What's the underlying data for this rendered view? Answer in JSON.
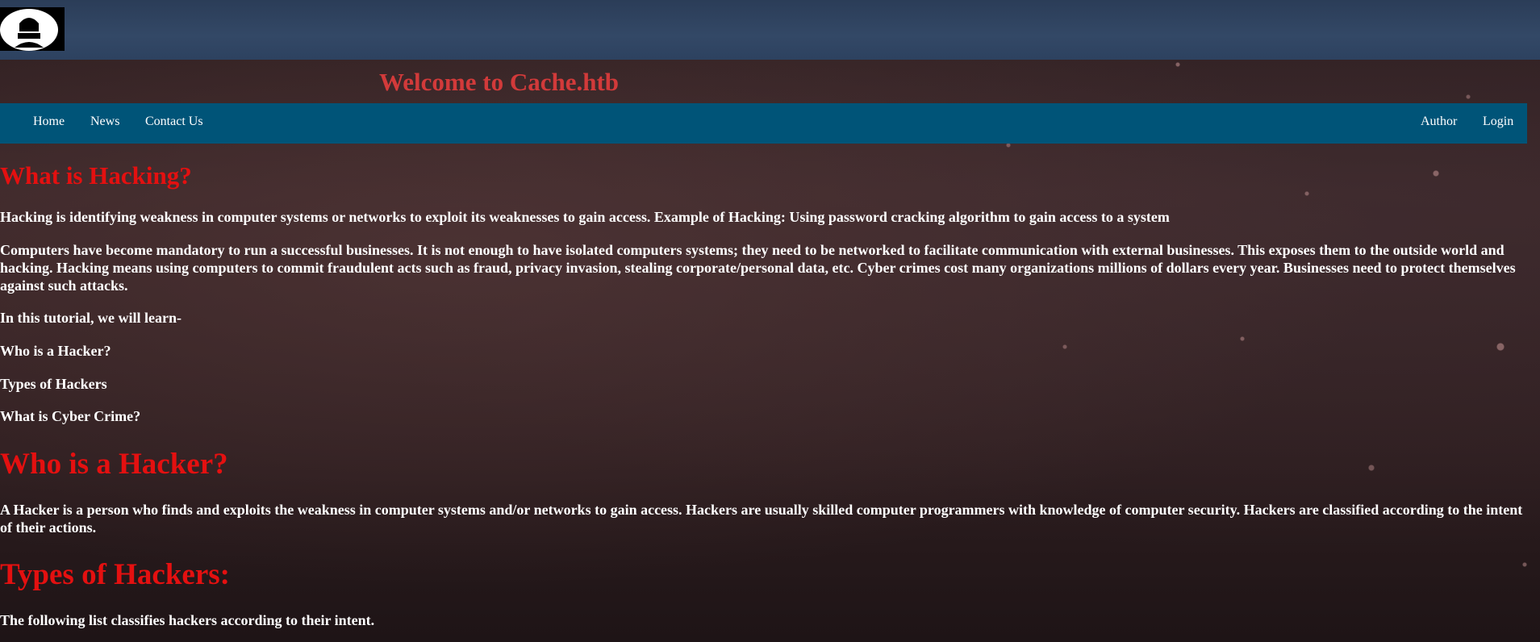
{
  "header": {
    "logo_icon": "hacker-avatar-icon",
    "title": "Welcome to Cache.htb"
  },
  "nav": {
    "left": [
      "Home",
      "News",
      "Contact Us"
    ],
    "right": [
      "Author",
      "Login"
    ]
  },
  "colors": {
    "nav_background": "#005478",
    "heading": "#e41010",
    "site_title": "#d23a3a",
    "text": "#ffffff"
  },
  "content": {
    "section1": {
      "heading": "What is Hacking?",
      "p1": "Hacking is identifying weakness in computer systems or networks to exploit its weaknesses to gain access. Example of Hacking: Using password cracking algorithm to gain access to a system",
      "p2": "Computers have become mandatory to run a successful businesses. It is not enough to have isolated computers systems; they need to be networked to facilitate communication with external businesses. This exposes them to the outside world and hacking. Hacking means using computers to commit fraudulent acts such as fraud, privacy invasion, stealing corporate/personal data, etc. Cyber crimes cost many organizations millions of dollars every year. Businesses need to protect themselves against such attacks.",
      "p3": "In this tutorial, we will learn-",
      "toc": [
        "Who is a Hacker?",
        "Types of Hackers",
        "What is Cyber Crime?"
      ]
    },
    "section2": {
      "heading": "Who is a Hacker?",
      "p1": "A Hacker is a person who finds and exploits the weakness in computer systems and/or networks to gain access. Hackers are usually skilled computer programmers with knowledge of computer security. Hackers are classified according to the intent of their actions."
    },
    "section3": {
      "heading": "Types of Hackers:",
      "p1": "The following list classifies hackers according to their intent."
    }
  }
}
